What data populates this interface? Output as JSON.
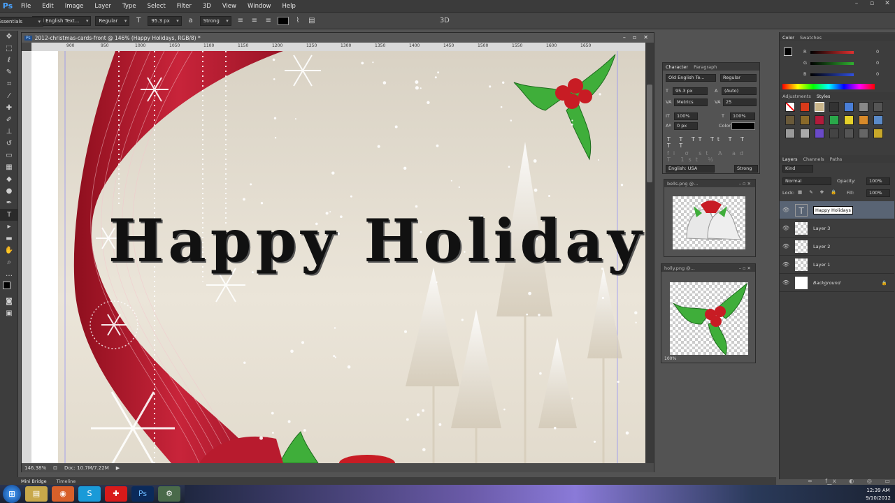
{
  "app": {
    "logo": "Ps"
  },
  "menu": [
    "File",
    "Edit",
    "Image",
    "Layer",
    "Type",
    "Select",
    "Filter",
    "3D",
    "View",
    "Window",
    "Help"
  ],
  "options": {
    "font_family": "Old English Text...",
    "font_style": "Regular",
    "font_size": "95.3 px",
    "aa": "Strong",
    "workspace": "Essentials"
  },
  "document": {
    "title": "2012-christmas-cards-front @ 146% (Happy Holidays, RGB/8) *",
    "zoom": "146.38%",
    "doc_size": "Doc: 10.7M/7.22M",
    "canvas_text": "Happy Holidays",
    "ruler_marks": [
      "900",
      "950",
      "1000",
      "1050",
      "1100",
      "1150",
      "1200",
      "1250",
      "1300",
      "1350",
      "1400",
      "1450",
      "1500",
      "1550",
      "1600",
      "1650"
    ]
  },
  "character": {
    "tabs": [
      "Character",
      "Paragraph"
    ],
    "font": "Old English Te...",
    "style": "Regular",
    "size": "95.3 px",
    "leading": "(Auto)",
    "kerning": "Metrics",
    "tracking": "25",
    "vscale": "100%",
    "hscale": "100%",
    "baseline": "0 px",
    "color_label": "Color:",
    "language": "English: USA",
    "aa": "Strong"
  },
  "floating": {
    "bells_title": "bells.png @...",
    "holly_title": "holly.png @...",
    "holly_zoom": "100%"
  },
  "color": {
    "tabs": [
      "Color",
      "Swatches"
    ],
    "r": "0",
    "g": "0",
    "b": "0",
    "accent_r": "#e03030",
    "accent_g": "#30b030",
    "accent_b": "#3050e0"
  },
  "styles": {
    "tabs": [
      "Adjustments",
      "Styles"
    ]
  },
  "layers": {
    "tabs": [
      "Layers",
      "Channels",
      "Paths"
    ],
    "kind": "Kind",
    "blend": "Normal",
    "opacity_label": "Opacity:",
    "opacity": "100%",
    "lock_label": "Lock:",
    "fill_label": "Fill:",
    "fill": "100%",
    "items": [
      {
        "name": "Happy Holidays",
        "type": "text"
      },
      {
        "name": "Layer 3",
        "type": "pixel"
      },
      {
        "name": "Layer 2",
        "type": "pixel"
      },
      {
        "name": "Layer 1",
        "type": "pixel"
      },
      {
        "name": "Background",
        "type": "background"
      }
    ]
  },
  "bottom_tabs": [
    "Mini Bridge",
    "Timeline"
  ],
  "clock": {
    "time": "12:39 AM",
    "date": "9/10/2012"
  }
}
